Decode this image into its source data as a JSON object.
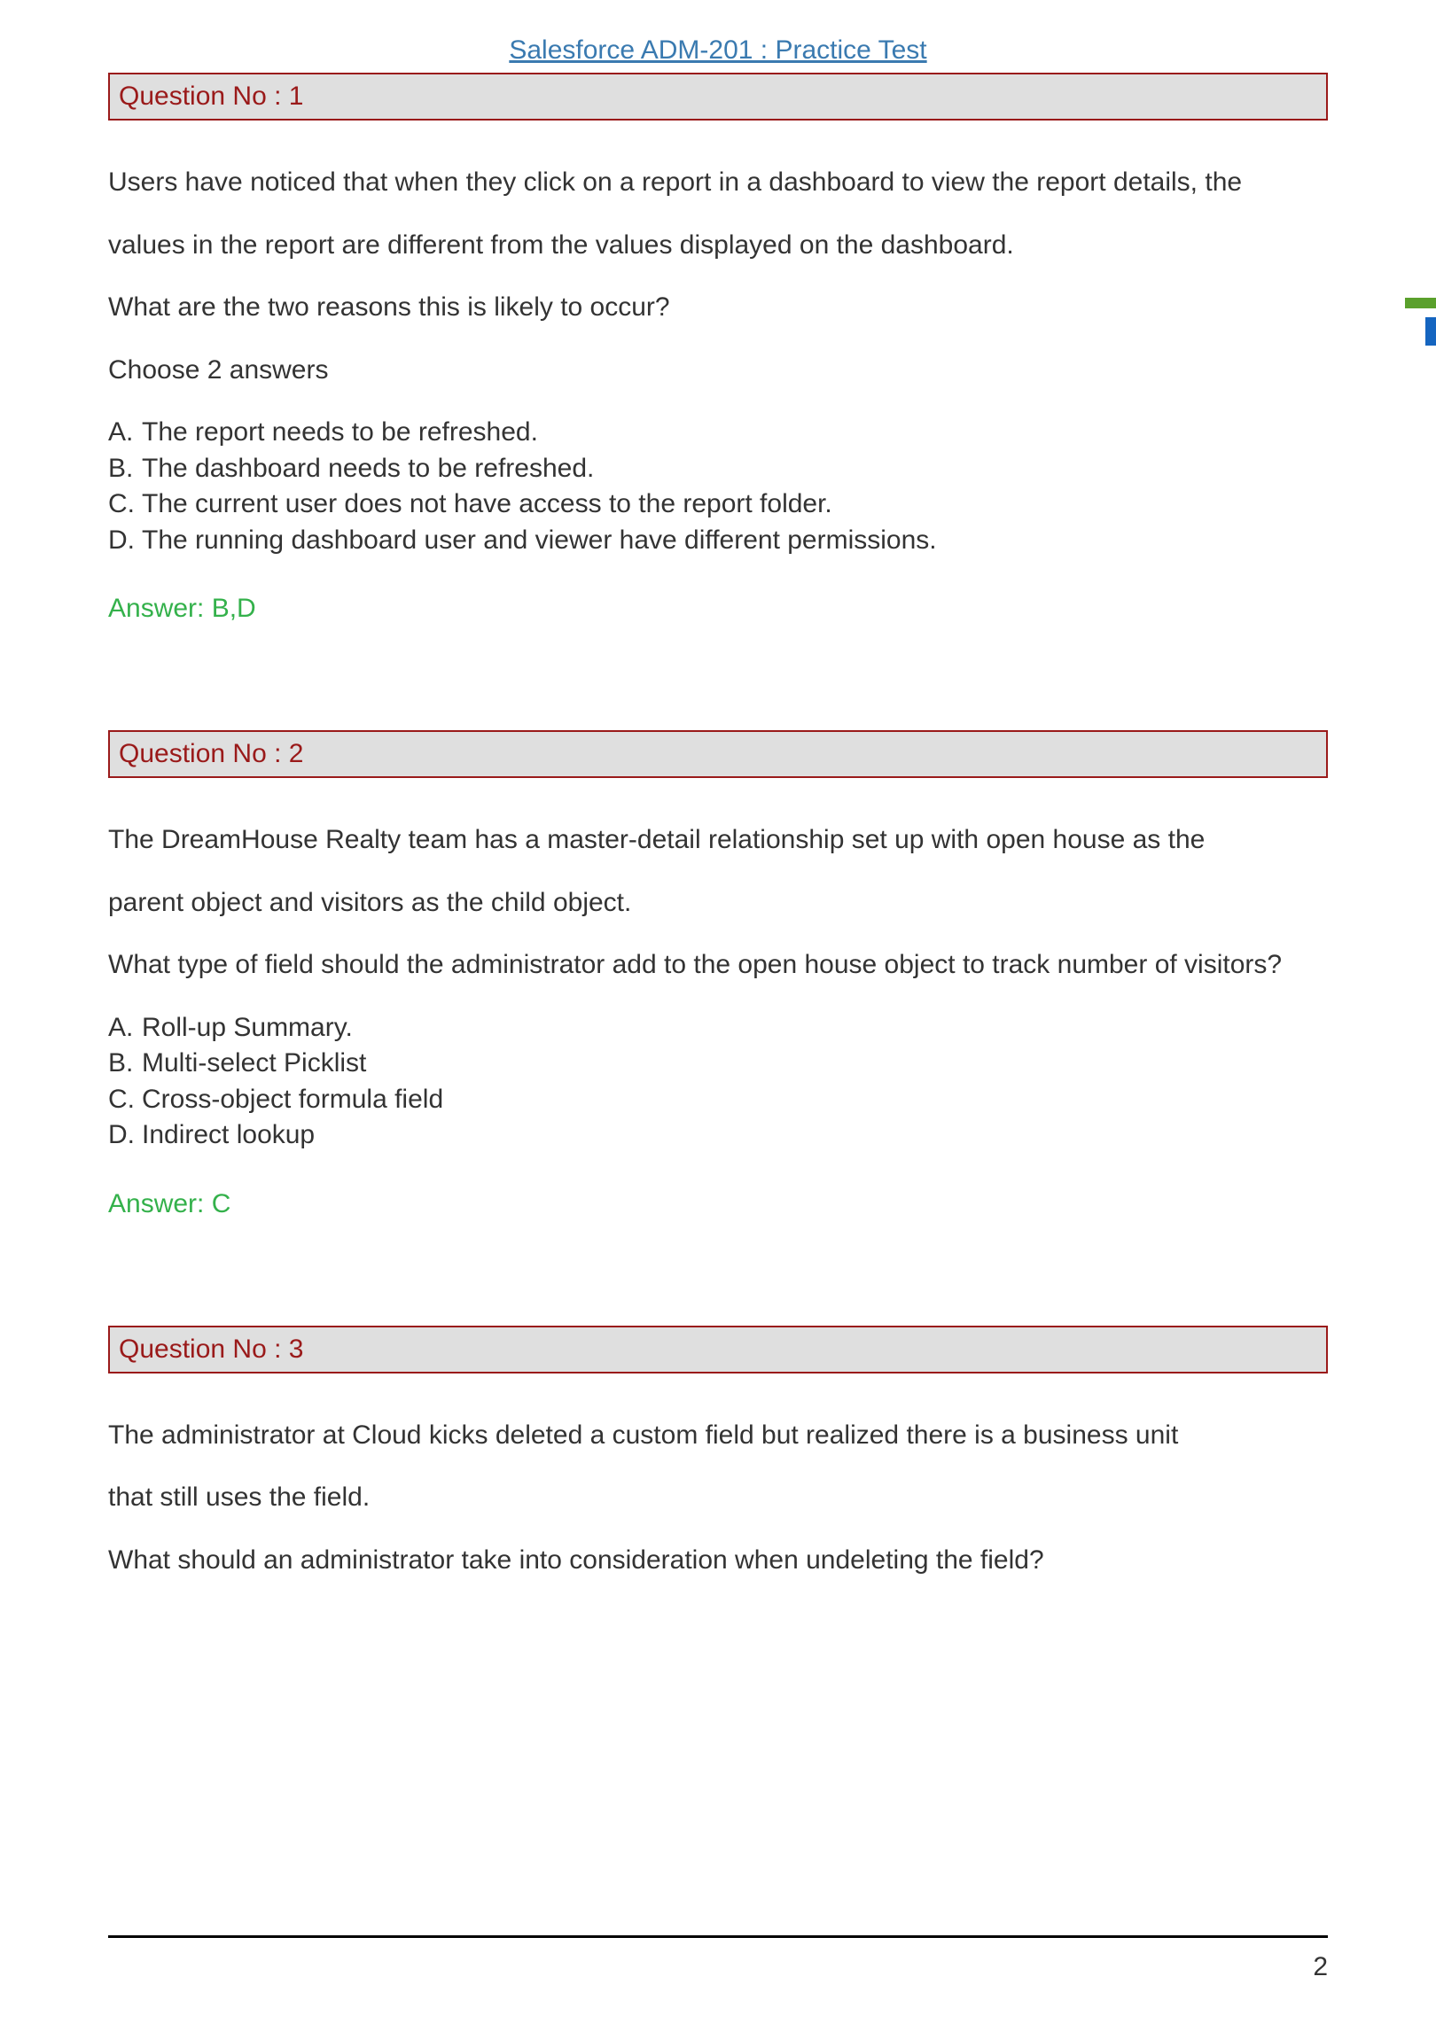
{
  "docTitle": "Salesforce ADM-201 : Practice Test",
  "pageNumber": "2",
  "questions": [
    {
      "header": "Question No : 1",
      "paragraphs": [
        "Users have noticed that when they click on a report in a dashboard to view the report details, the",
        "values in the report are different from the values displayed on the dashboard.",
        "What are the two reasons this is likely to occur?",
        "Choose 2 answers"
      ],
      "options": [
        "The report needs to be refreshed.",
        "The dashboard needs to be refreshed.",
        "The current user does not have access to the report folder.",
        "The running dashboard user and viewer have different permissions."
      ],
      "answer": "Answer: B,D"
    },
    {
      "header": "Question No : 2",
      "paragraphs": [
        "The DreamHouse Realty team has a master-detail relationship set up with open house as the",
        "parent object and visitors as the child object.",
        "What type of field should the administrator add to the open house object to track number of visitors?"
      ],
      "options": [
        "Roll-up Summary.",
        "Multi-select Picklist",
        "Cross-object formula field",
        "Indirect lookup"
      ],
      "answer": "Answer: C"
    },
    {
      "header": "Question No : 3",
      "paragraphs": [
        "The administrator at Cloud kicks deleted a custom field but realized there is a business unit",
        "that still uses the field.",
        "What should an administrator take into consideration when undeleting the field?"
      ],
      "options": [],
      "answer": ""
    }
  ]
}
